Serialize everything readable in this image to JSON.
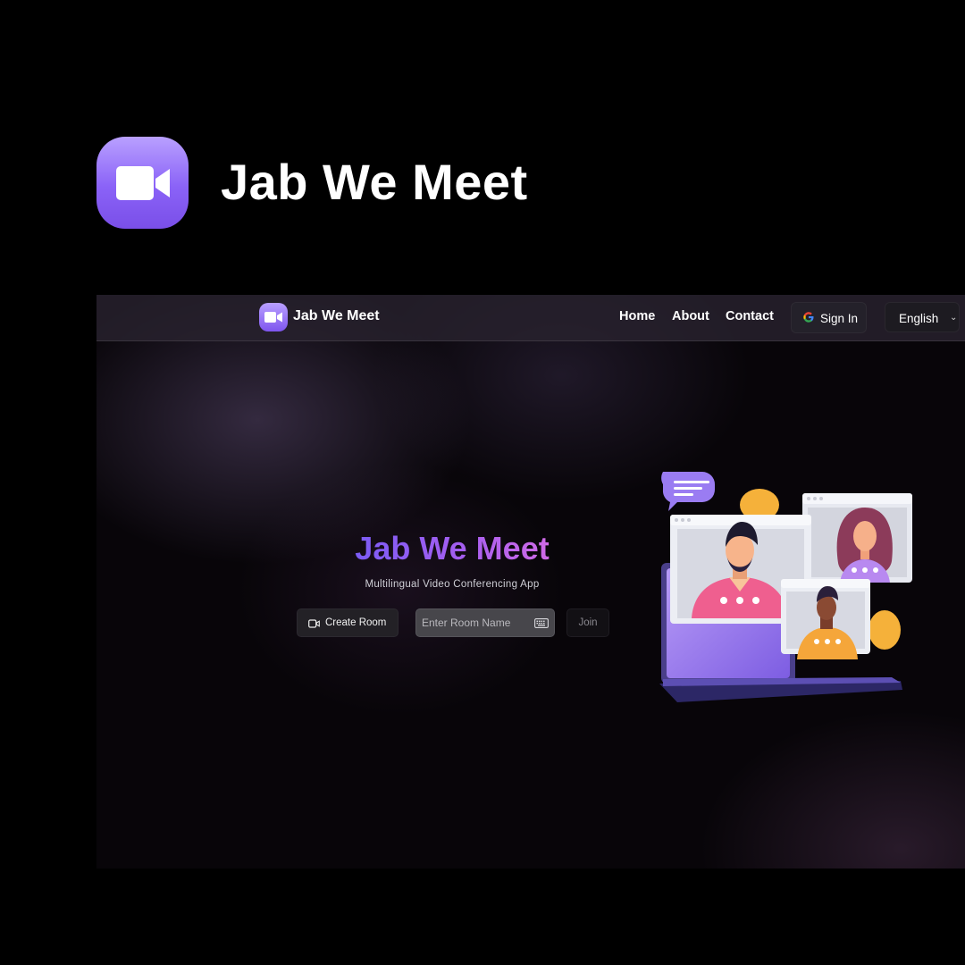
{
  "promo": {
    "title": "Jab We Meet",
    "logo_icon": "video-camera-icon",
    "logo_color": "#8a62f7"
  },
  "navbar": {
    "brand": "Jab We Meet",
    "links": [
      "Home",
      "About",
      "Contact"
    ],
    "signin_label": "Sign In",
    "signin_icon": "google-icon",
    "language": {
      "selected": "English",
      "options": [
        "English"
      ]
    }
  },
  "hero": {
    "title": "Jab We Meet",
    "subtitle": "Multilingual Video Conferencing App",
    "create_label": "Create Room",
    "create_icon": "video-icon",
    "input_placeholder": "Enter Room Name",
    "input_value": "",
    "input_icon": "keyboard-icon",
    "join_label": "Join",
    "title_gradient": [
      "#7b5cf5",
      "#cf6ae6"
    ]
  },
  "illustration": {
    "name": "video-conference-illustration",
    "colors": [
      "#9a7cf2",
      "#f06a9a",
      "#f5b13a",
      "#e7e9f0"
    ]
  }
}
